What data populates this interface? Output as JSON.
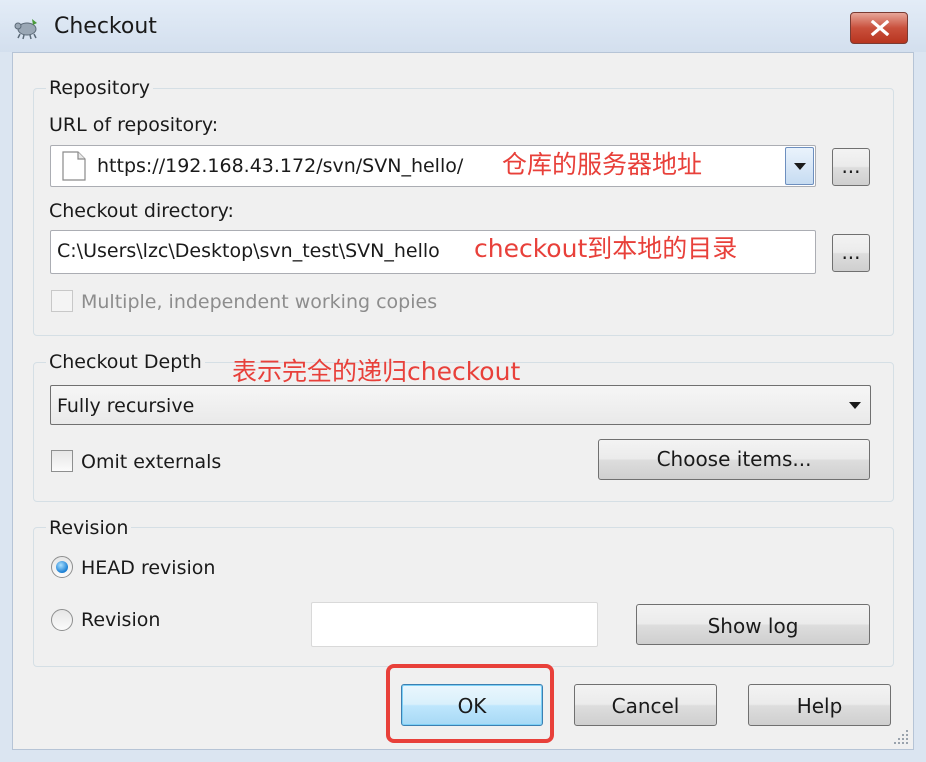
{
  "window": {
    "title": "Checkout",
    "close_glyph": "✕"
  },
  "repository": {
    "group_label": "Repository",
    "url_label": "URL of repository:",
    "url_value": "https://192.168.43.172/svn/SVN_hello/",
    "url_browse": "...",
    "dir_label": "Checkout directory:",
    "dir_value": "C:\\Users\\lzc\\Desktop\\svn_test\\SVN_hello",
    "dir_browse": "...",
    "multiple_label": "Multiple, independent working copies",
    "multiple_checked": false
  },
  "depth": {
    "group_label": "Checkout Depth",
    "selected": "Fully recursive",
    "omit_externals_label": "Omit externals",
    "omit_externals_checked": false,
    "choose_items_label": "Choose items..."
  },
  "revision": {
    "group_label": "Revision",
    "head_label": "HEAD revision",
    "head_selected": true,
    "revision_label": "Revision",
    "revision_value": "",
    "show_log_label": "Show log"
  },
  "footer": {
    "ok_label": "OK",
    "cancel_label": "Cancel",
    "help_label": "Help"
  },
  "annotations": {
    "url_note": "仓库的服务器地址",
    "dir_note": "checkout到本地的目录",
    "depth_note": "表示完全的递归checkout"
  },
  "colors": {
    "annotation": "#e8403a",
    "highlight_border": "#e8403a"
  }
}
